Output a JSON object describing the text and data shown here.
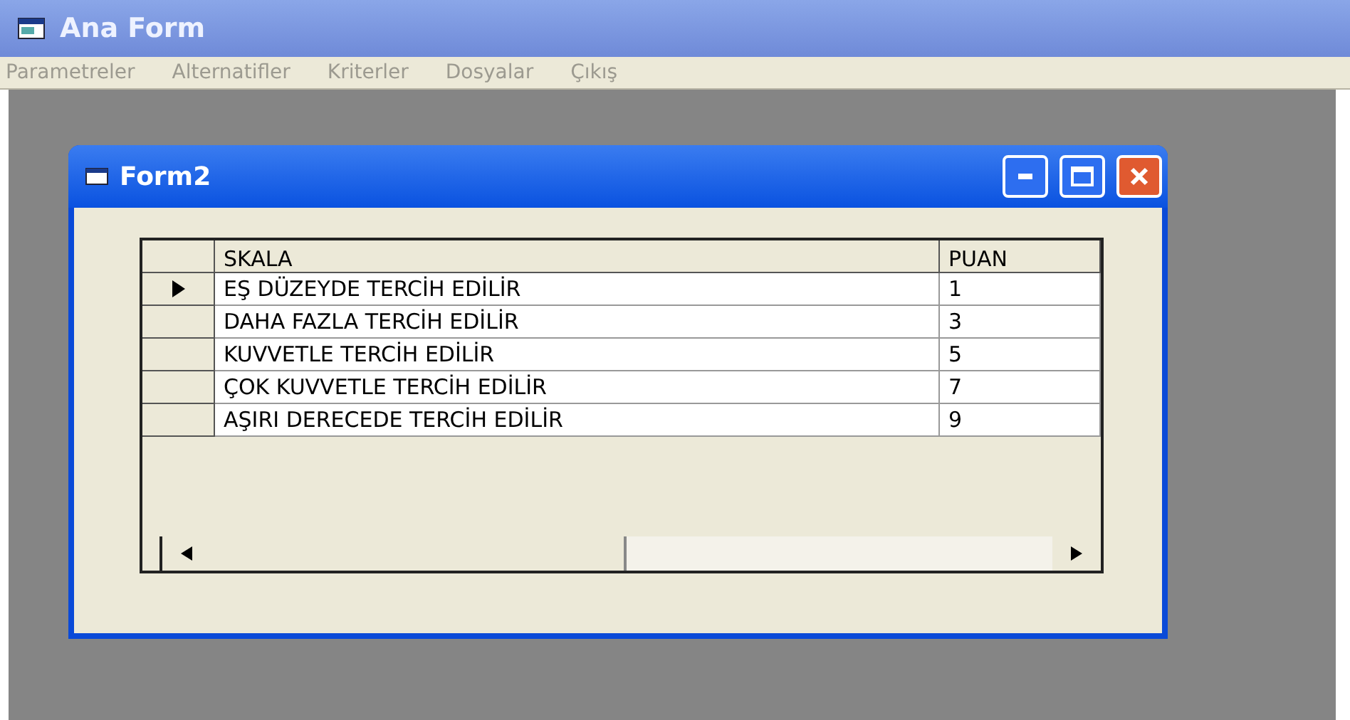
{
  "window": {
    "title": "Ana Form"
  },
  "menu": [
    "Parametreler",
    "Alternatifler",
    "Kriterler",
    "Dosyalar",
    "Çıkış"
  ],
  "form": {
    "title": "Form2",
    "table": {
      "columns": [
        "SKALA",
        "PUAN"
      ],
      "rows": [
        {
          "cells": [
            "EŞ DÜZEYDE TERCİH EDİLİR",
            "1"
          ],
          "selected": true
        },
        {
          "cells": [
            "DAHA FAZLA TERCİH EDİLİR",
            "3"
          ],
          "selected": false
        },
        {
          "cells": [
            "KUVVETLE TERCİH EDİLİR",
            "5"
          ],
          "selected": false
        },
        {
          "cells": [
            "ÇOK KUVVETLE TERCİH EDİLİR",
            "7"
          ],
          "selected": false
        },
        {
          "cells": [
            "AŞIRI DERECEDE TERCİH EDİLİR",
            "9"
          ],
          "selected": false
        }
      ]
    }
  }
}
